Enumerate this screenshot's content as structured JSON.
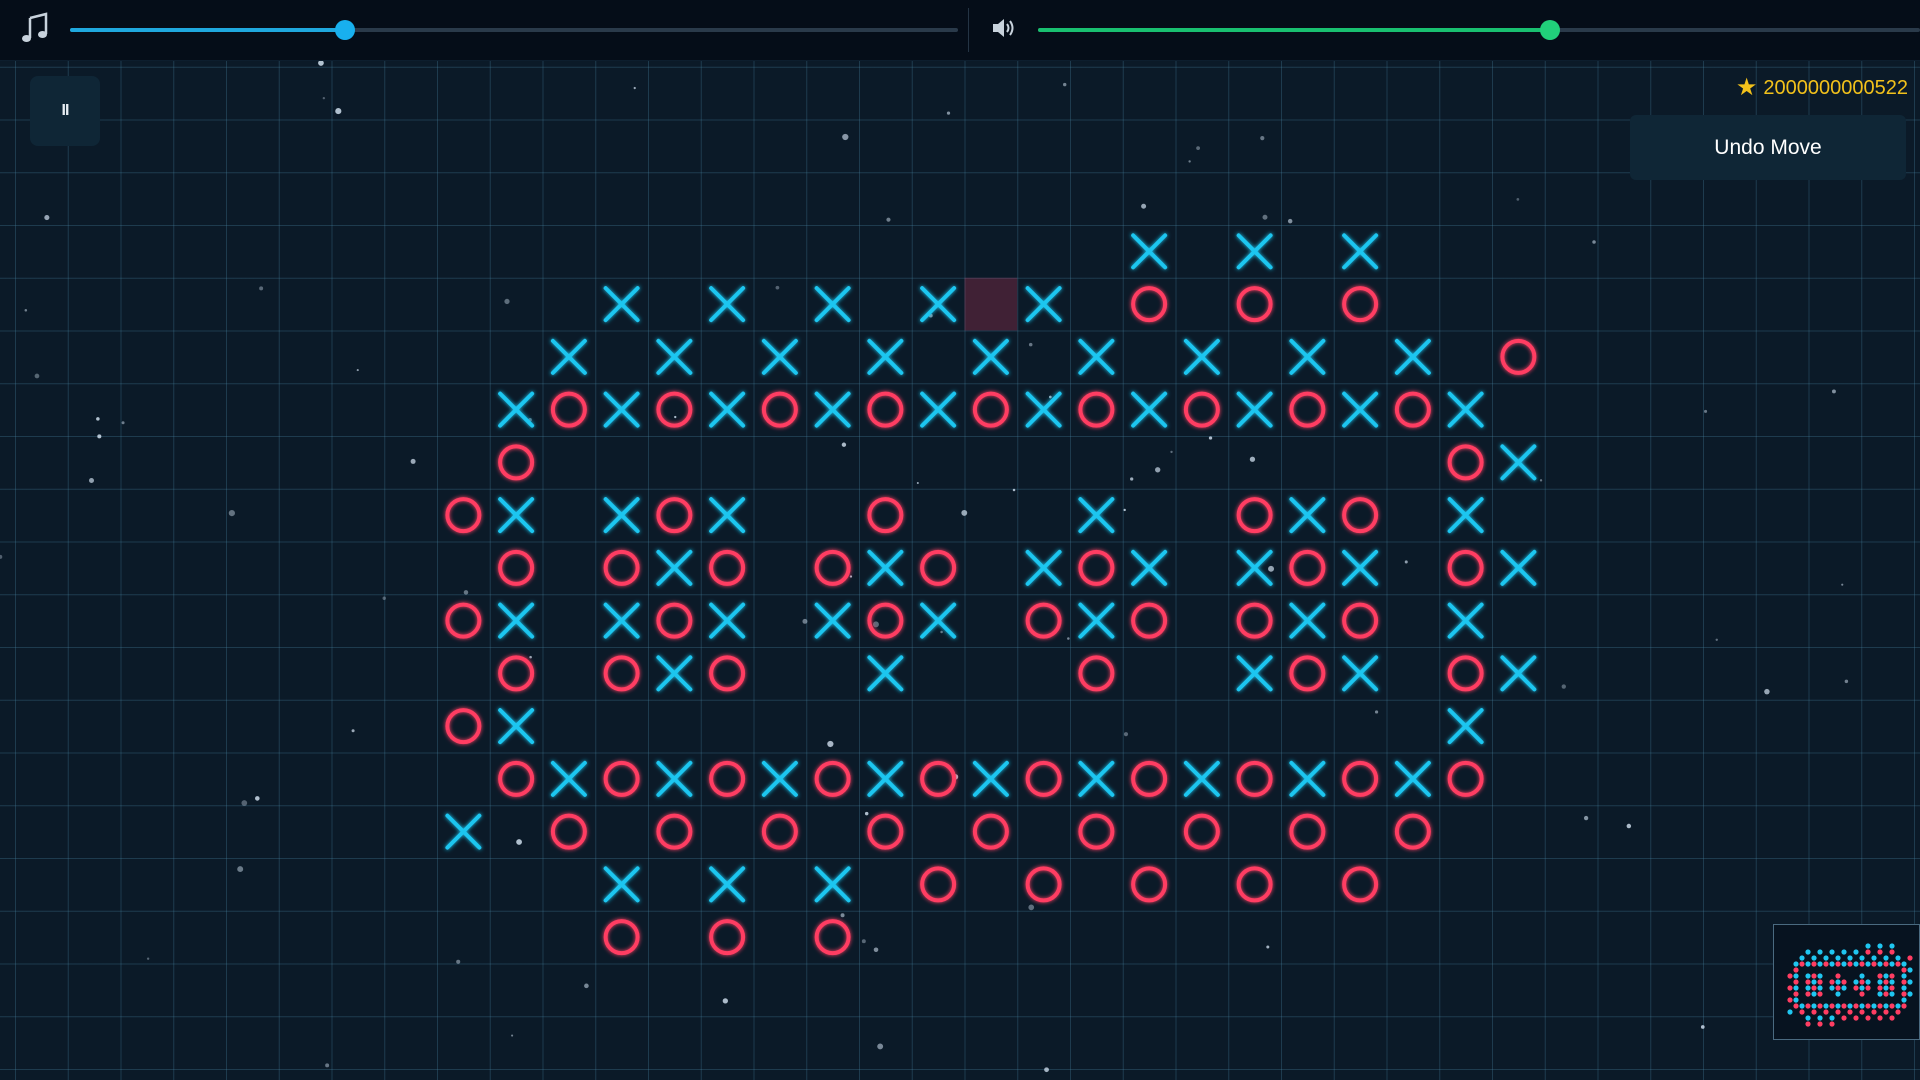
{
  "audio": {
    "music_icon": "music-note-icon",
    "music_volume": 0.31,
    "music_color": "#1fa8de",
    "sound_icon": "speaker-icon",
    "sound_volume": 0.58,
    "sound_color": "#19c070"
  },
  "controls": {
    "pause_label": "II",
    "undo_label": "Undo Move"
  },
  "score": {
    "icon": "star-icon",
    "value": "2000000000522",
    "color": "#f2c11b"
  },
  "board": {
    "x_color": "#1fc6f0",
    "o_color": "#ff3d62",
    "last_move": [
      18,
      5
    ],
    "rows": [
      {
        "row": 4,
        "x": [
          21,
          23,
          25
        ],
        "o": []
      },
      {
        "row": 5,
        "x": [
          11,
          13,
          15,
          17,
          19
        ],
        "o": [
          21,
          23,
          25
        ]
      },
      {
        "row": 6,
        "x": [
          10,
          12,
          14,
          16,
          18,
          20,
          22,
          24,
          26
        ],
        "o": [
          28
        ]
      },
      {
        "row": 7,
        "x": [
          9,
          11,
          13,
          15,
          17,
          19,
          21,
          23,
          25,
          27
        ],
        "o": [
          10,
          12,
          14,
          16,
          18,
          20,
          22,
          24,
          26
        ]
      },
      {
        "row": 8,
        "x": [
          28
        ],
        "o": [
          9,
          27
        ]
      },
      {
        "row": 9,
        "x": [
          9,
          11,
          13,
          20,
          24,
          27
        ],
        "o": [
          8,
          12,
          16,
          23,
          25
        ]
      },
      {
        "row": 10,
        "x": [
          12,
          16,
          19,
          21,
          23,
          25,
          28
        ],
        "o": [
          9,
          11,
          13,
          15,
          17,
          20,
          24,
          27
        ]
      },
      {
        "row": 11,
        "x": [
          9,
          11,
          13,
          15,
          17,
          20,
          24,
          27
        ],
        "o": [
          8,
          12,
          16,
          19,
          21,
          23,
          25
        ]
      },
      {
        "row": 12,
        "x": [
          12,
          16,
          23,
          25,
          28
        ],
        "o": [
          9,
          11,
          13,
          20,
          24,
          27
        ]
      },
      {
        "row": 13,
        "x": [
          9,
          27
        ],
        "o": [
          8
        ]
      },
      {
        "row": 14,
        "x": [
          10,
          12,
          14,
          16,
          18,
          20,
          22,
          24,
          26
        ],
        "o": [
          9,
          11,
          13,
          15,
          17,
          19,
          21,
          23,
          25,
          27
        ]
      },
      {
        "row": 15,
        "x": [
          8
        ],
        "o": [
          10,
          12,
          14,
          16,
          18,
          20,
          22,
          24,
          26
        ]
      },
      {
        "row": 16,
        "x": [
          11,
          13,
          15
        ],
        "o": [
          17,
          19,
          21,
          23,
          25
        ]
      },
      {
        "row": 17,
        "x": [],
        "o": [
          11,
          13,
          15
        ]
      }
    ]
  }
}
